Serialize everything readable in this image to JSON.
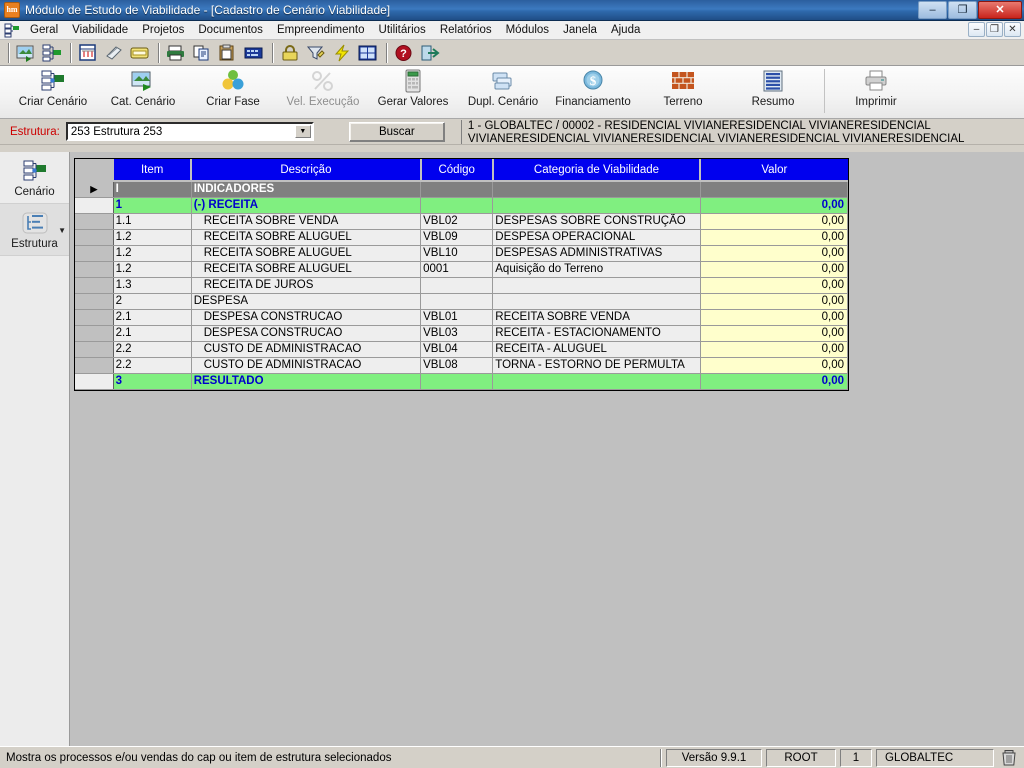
{
  "window": {
    "title": "Módulo de Estudo de Viabilidade - [Cadastro de Cenário Viabilidade]",
    "app_icon": "hm-icon",
    "controls": {
      "minimize": "–",
      "restore": "❐",
      "close": "✕"
    }
  },
  "mdi_controls": {
    "minimize": "–",
    "restore": "❐",
    "close": "✕"
  },
  "menubar": {
    "icon": "mdi-window-icon",
    "items": [
      {
        "label": "Geral",
        "accel": "G"
      },
      {
        "label": "Viabilidade",
        "accel": "V"
      },
      {
        "label": "Projetos",
        "accel": "P"
      },
      {
        "label": "Documentos",
        "accel": "D"
      },
      {
        "label": "Empreendimento",
        "accel": "E"
      },
      {
        "label": "Utilitários",
        "accel": "U"
      },
      {
        "label": "Relatórios",
        "accel": "R"
      },
      {
        "label": "Módulos",
        "accel": "M"
      },
      {
        "label": "Janela",
        "accel": "J"
      },
      {
        "label": "Ajuda",
        "accel": "A"
      }
    ]
  },
  "small_toolbar": {
    "icons": [
      "picture-export-icon",
      "structure-tree-icon",
      "calendar-icon",
      "attachment-icon",
      "card-icon",
      "print-icon",
      "copy-icon",
      "paste-icon",
      "keyboard-icon",
      "lock-icon",
      "filter-icon",
      "lightning-icon",
      "table-icon",
      "help-icon",
      "exit-icon"
    ]
  },
  "big_toolbar": {
    "buttons": [
      {
        "label": "Criar Cenário",
        "icon": "create-scenario-icon",
        "disabled": false
      },
      {
        "label": "Cat. Cenário",
        "icon": "scenario-catalog-icon",
        "disabled": false
      },
      {
        "label": "Criar Fase",
        "icon": "create-phase-icon",
        "disabled": false
      },
      {
        "label": "Vel. Execução",
        "icon": "percent-icon",
        "disabled": true
      },
      {
        "label": "Gerar Valores",
        "icon": "calculator-icon",
        "disabled": false
      },
      {
        "label": "Dupl. Cenário",
        "icon": "duplicate-icon",
        "disabled": false
      },
      {
        "label": "Financiamento",
        "icon": "dollar-coin-icon",
        "disabled": false
      },
      {
        "label": "Terreno",
        "icon": "brick-wall-icon",
        "disabled": false
      },
      {
        "label": "Resumo",
        "icon": "summary-icon",
        "disabled": false
      },
      {
        "label": "Imprimir",
        "icon": "printer-icon",
        "disabled": false
      }
    ]
  },
  "struct_row": {
    "label": "Estrutura:",
    "combo_value": "253  Estrutura 253",
    "combo_arrow": "▼",
    "buscar_label": "Buscar",
    "project_line1": "1 - GLOBALTEC / 00002 - RESIDENCIAL VIVIANERESIDENCIAL VIVIANERESIDENCIAL",
    "project_line2": "VIVIANERESIDENCIAL VIVIANERESIDENCIAL VIVIANERESIDENCIAL VIVIANERESIDENCIAL"
  },
  "leftnav": {
    "items": [
      {
        "label": "Cenário",
        "icon": "scenario-icon",
        "active": false,
        "chevron": false
      },
      {
        "label": "Estrutura",
        "icon": "structure-icon",
        "active": true,
        "chevron": true
      }
    ],
    "chevron_glyph": "▼"
  },
  "grid": {
    "columns": [
      "Item",
      "Descrição",
      "Código",
      "Categoria de Viabilidade",
      "Valor"
    ],
    "row_marker": "▶",
    "rows": [
      {
        "marker": true,
        "type": "head",
        "item": "I",
        "desc": "INDICADORES",
        "indent": false,
        "codigo": "",
        "categoria": "",
        "valor": ""
      },
      {
        "marker": false,
        "type": "total",
        "item": "1",
        "desc": "(-) RECEITA",
        "indent": false,
        "codigo": "",
        "categoria": "",
        "valor": "0,00"
      },
      {
        "marker": false,
        "type": "data",
        "item": "1.1",
        "desc": "RECEITA SOBRE VENDA",
        "indent": true,
        "codigo": "VBL02",
        "categoria": "DESPESAS SOBRE CONSTRUÇÃO",
        "valor": "0,00"
      },
      {
        "marker": false,
        "type": "data",
        "item": "1.2",
        "desc": "RECEITA SOBRE ALUGUEL",
        "indent": true,
        "codigo": "VBL09",
        "categoria": "DESPESA OPERACIONAL",
        "valor": "0,00"
      },
      {
        "marker": false,
        "type": "data",
        "item": "1.2",
        "desc": "RECEITA SOBRE ALUGUEL",
        "indent": true,
        "codigo": "VBL10",
        "categoria": "DESPESAS ADMINISTRATIVAS",
        "valor": "0,00"
      },
      {
        "marker": false,
        "type": "data",
        "item": "1.2",
        "desc": "RECEITA SOBRE ALUGUEL",
        "indent": true,
        "codigo": "0001",
        "categoria": "Aquisição do Terreno",
        "valor": "0,00"
      },
      {
        "marker": false,
        "type": "data",
        "item": "1.3",
        "desc": "RECEITA DE JUROS",
        "indent": true,
        "codigo": "",
        "categoria": "",
        "valor": "0,00"
      },
      {
        "marker": false,
        "type": "data",
        "item": "2",
        "desc": "DESPESA",
        "indent": false,
        "codigo": "",
        "categoria": "",
        "valor": "0,00"
      },
      {
        "marker": false,
        "type": "data",
        "item": "2.1",
        "desc": "DESPESA CONSTRUCAO",
        "indent": true,
        "codigo": "VBL01",
        "categoria": "RECEITA SOBRE VENDA",
        "valor": "0,00"
      },
      {
        "marker": false,
        "type": "data",
        "item": "2.1",
        "desc": "DESPESA CONSTRUCAO",
        "indent": true,
        "codigo": "VBL03",
        "categoria": "RECEITA - ESTACIONAMENTO",
        "valor": "0,00"
      },
      {
        "marker": false,
        "type": "data",
        "item": "2.2",
        "desc": "CUSTO DE ADMINISTRACAO",
        "indent": true,
        "codigo": "VBL04",
        "categoria": "RECEITA - ALUGUEL",
        "valor": "0,00"
      },
      {
        "marker": false,
        "type": "data",
        "item": "2.2",
        "desc": "CUSTO DE ADMINISTRACAO",
        "indent": true,
        "codigo": "VBL08",
        "categoria": "TORNA - ESTORNO DE PERMULTA",
        "valor": "0,00"
      },
      {
        "marker": false,
        "type": "total",
        "item": "3",
        "desc": "RESULTADO",
        "indent": false,
        "codigo": "",
        "categoria": "",
        "valor": "0,00"
      }
    ]
  },
  "statusbar": {
    "message": "Mostra os processos e/ou vendas do cap ou item de estrutura selecionados",
    "version": "Versão 9.9.1",
    "user": "ROOT",
    "company_code": "1",
    "company": "GLOBALTEC",
    "trash_icon": "trash-icon"
  },
  "colors": {
    "titlebar": "#2f6aad",
    "header_blue": "#0000ee",
    "total_green": "#80ef80",
    "value_yellow": "#ffffcc",
    "selected_gray": "#808080",
    "label_red": "#cc0000",
    "face": "#d4d0c8"
  }
}
